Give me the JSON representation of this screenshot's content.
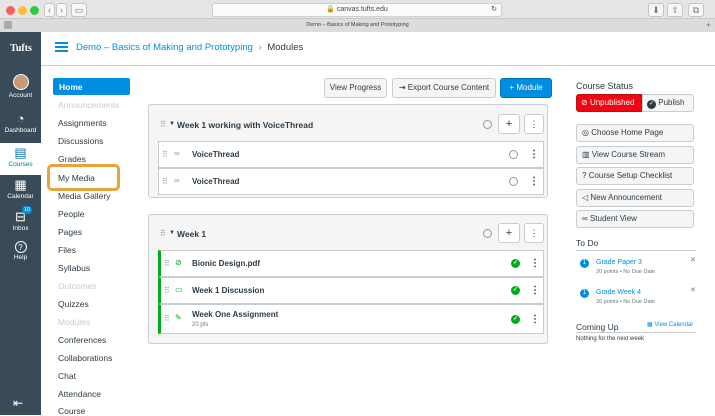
{
  "browser": {
    "url": "canvas.tufts.edu",
    "tab_title": "Demo – Basics of Making and Prototyping"
  },
  "global_nav": {
    "logo": "Tufts",
    "items": [
      {
        "label": "Account",
        "icon": "avatar"
      },
      {
        "label": "Dashboard",
        "icon": "speedometer-icon"
      },
      {
        "label": "Courses",
        "icon": "book-icon"
      },
      {
        "label": "Calendar",
        "icon": "calendar-icon"
      },
      {
        "label": "Inbox",
        "icon": "inbox-icon",
        "badge": "10"
      },
      {
        "label": "Help",
        "icon": "help-icon"
      }
    ],
    "collapse_icon": "collapse-icon"
  },
  "header": {
    "course": "Demo – Basics of Making and Prototyping",
    "separator": "›",
    "page": "Modules"
  },
  "course_nav": {
    "items": [
      {
        "label": "Home",
        "state": "active"
      },
      {
        "label": "Announcements",
        "state": "disabled"
      },
      {
        "label": "Assignments",
        "state": "normal"
      },
      {
        "label": "Discussions",
        "state": "normal"
      },
      {
        "label": "Grades",
        "state": "normal"
      },
      {
        "label": "My Media",
        "state": "highlighted"
      },
      {
        "label": "Media Gallery",
        "state": "normal"
      },
      {
        "label": "People",
        "state": "normal"
      },
      {
        "label": "Pages",
        "state": "normal"
      },
      {
        "label": "Files",
        "state": "normal"
      },
      {
        "label": "Syllabus",
        "state": "normal"
      },
      {
        "label": "Outcomes",
        "state": "disabled"
      },
      {
        "label": "Quizzes",
        "state": "normal"
      },
      {
        "label": "Modules",
        "state": "disabled"
      },
      {
        "label": "Conferences",
        "state": "normal"
      },
      {
        "label": "Collaborations",
        "state": "normal"
      },
      {
        "label": "Chat",
        "state": "normal"
      },
      {
        "label": "Attendance",
        "state": "normal"
      },
      {
        "label": "Course",
        "state": "normal"
      }
    ],
    "highlight_color": "#e8a33d"
  },
  "toolbar": {
    "view_progress": "View Progress",
    "export": "Export Course Content",
    "add_module": "Module"
  },
  "modules": [
    {
      "title": "Week 1 working with VoiceThread",
      "items": [
        {
          "title": "VoiceThread",
          "icon": "link-icon",
          "published": false
        },
        {
          "title": "VoiceThread",
          "icon": "link-icon",
          "published": false
        }
      ]
    },
    {
      "title": "Week 1",
      "items": [
        {
          "title": "Bionic Design.pdf",
          "icon": "attachment-icon",
          "published": true
        },
        {
          "title": "Week 1 Discussion",
          "icon": "discussion-icon",
          "published": true
        },
        {
          "title": "Week One Assignment",
          "icon": "assignment-icon",
          "published": true,
          "points": "20 pts"
        }
      ]
    }
  ],
  "sidebar": {
    "status_heading": "Course Status",
    "unpublished": "Unpublished",
    "publish": "Publish",
    "buttons": [
      {
        "label": "Choose Home Page",
        "icon": "target-icon"
      },
      {
        "label": "View Course Stream",
        "icon": "stream-icon"
      },
      {
        "label": "Course Setup Checklist",
        "icon": "question-icon"
      },
      {
        "label": "New Announcement",
        "icon": "megaphone-icon"
      },
      {
        "label": "Student View",
        "icon": "glasses-icon"
      }
    ],
    "todo_heading": "To Do",
    "todo": [
      {
        "title": "Grade Paper 3",
        "meta": "20 points • No Due Date",
        "count": "1"
      },
      {
        "title": "Grade Week 4",
        "meta": "20 points • No Due Date",
        "count": "1"
      }
    ],
    "coming_up_heading": "Coming Up",
    "view_calendar": "View Calendar",
    "coming_up_empty": "Nothing for the next week"
  },
  "colors": {
    "nav_bg": "#394b58",
    "brand_blue": "#008ee2",
    "link_blue": "#0770a3",
    "danger": "#ee0612",
    "success": "#00ac18"
  }
}
